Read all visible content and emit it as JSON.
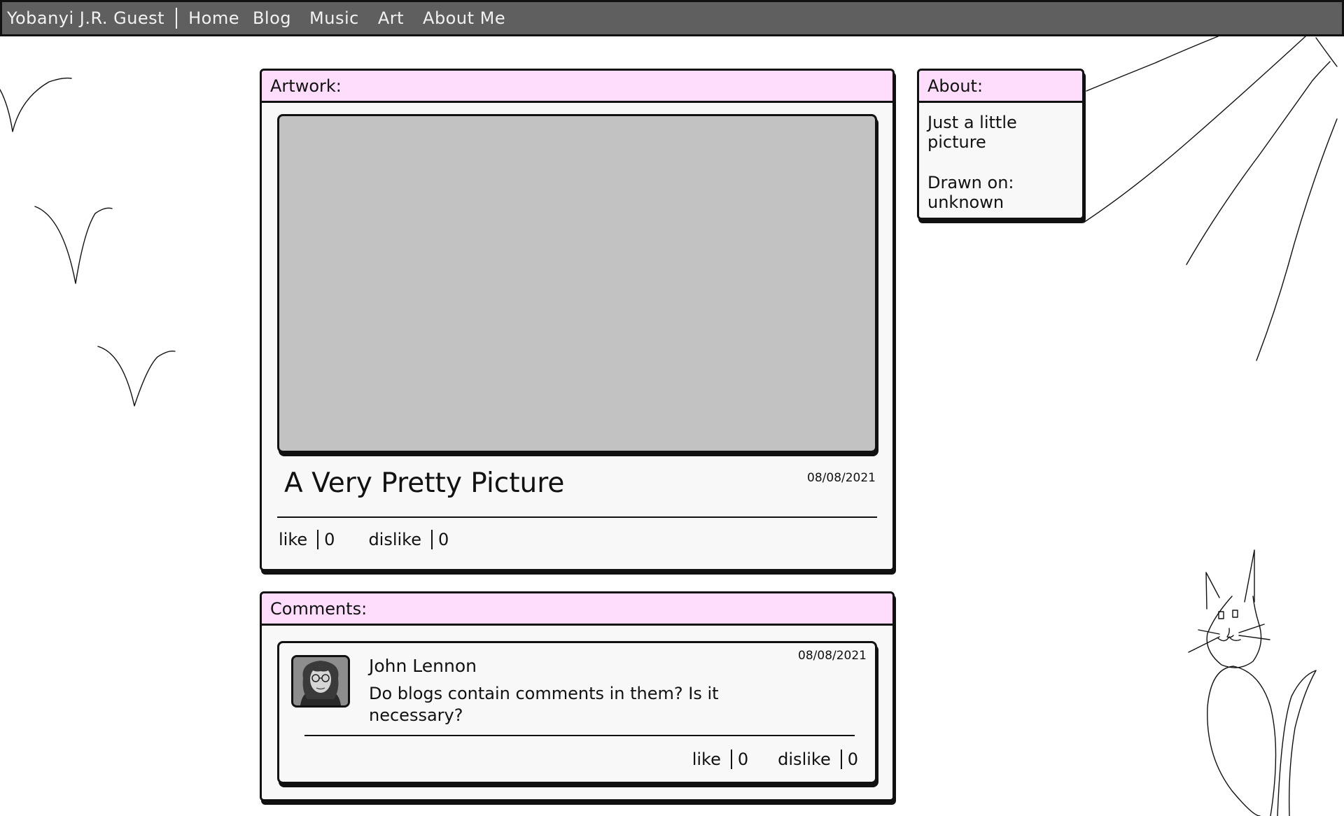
{
  "nav": {
    "brand": "Yobanyi J.R. Guest",
    "links": [
      {
        "label": "Home"
      },
      {
        "label": "Blog"
      },
      {
        "label": "Music"
      },
      {
        "label": "Art"
      },
      {
        "label": "About Me"
      }
    ]
  },
  "artwork": {
    "header": "Artwork:",
    "title": "A Very Pretty Picture",
    "date": "08/08/2021",
    "like_label": "like",
    "like_count": "0",
    "dislike_label": "dislike",
    "dislike_count": "0"
  },
  "about": {
    "header": "About:",
    "description": "Just a little picture",
    "drawn_on_label": "Drawn on:",
    "drawn_on_value": "unknown"
  },
  "comments": {
    "header": "Comments:",
    "items": [
      {
        "author": "John Lennon",
        "date": "08/08/2021",
        "text": "Do blogs contain comments in them? Is it necessary?",
        "like_label": "like",
        "like_count": "0",
        "dislike_label": "dislike",
        "dislike_count": "0"
      }
    ]
  },
  "colors": {
    "nav_background": "#5f5f5f",
    "panel_header": "#fedcfb",
    "panel_body": "#f8f8f8",
    "image_placeholder": "#c2c2c2"
  }
}
